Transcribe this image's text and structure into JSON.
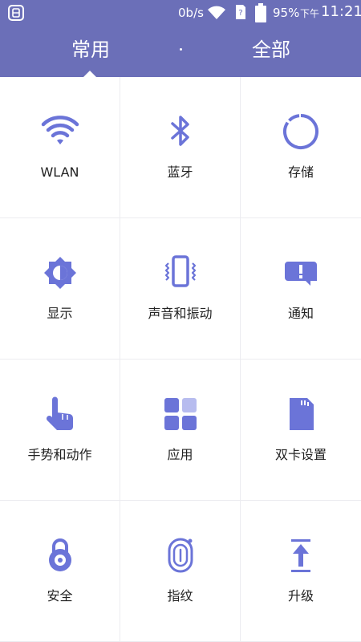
{
  "status_bar": {
    "net_speed": "0b/s",
    "battery_percent": "95%",
    "am_pm": "下午",
    "time": "11:21"
  },
  "tabs": [
    {
      "label": "常用",
      "selected": true
    },
    {
      "label": "全部",
      "selected": false
    }
  ],
  "colors": {
    "header": "#6b6fb8",
    "icon": "#6b74d8"
  },
  "items": [
    {
      "label": "WLAN",
      "icon": "wifi-icon"
    },
    {
      "label": "蓝牙",
      "icon": "bluetooth-icon"
    },
    {
      "label": "存储",
      "icon": "storage-icon"
    },
    {
      "label": "显示",
      "icon": "display-brightness-icon"
    },
    {
      "label": "声音和振动",
      "icon": "sound-vibration-icon"
    },
    {
      "label": "通知",
      "icon": "notification-icon"
    },
    {
      "label": "手势和动作",
      "icon": "gesture-hand-icon"
    },
    {
      "label": "应用",
      "icon": "apps-grid-icon"
    },
    {
      "label": "双卡设置",
      "icon": "sim-card-icon"
    },
    {
      "label": "安全",
      "icon": "lock-icon"
    },
    {
      "label": "指纹",
      "icon": "fingerprint-icon"
    },
    {
      "label": "升级",
      "icon": "upgrade-arrow-icon"
    }
  ]
}
